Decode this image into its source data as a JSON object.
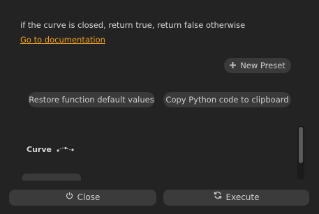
{
  "description": "if the curve is closed, return true, return false otherwise",
  "doc_link": "Go to documentation",
  "presets": {
    "new_preset_label": "New Preset",
    "icon": "plus-icon"
  },
  "actions": {
    "restore_label": "Restore function default values",
    "copy_label": "Copy Python code to clipboard"
  },
  "parameters": [
    {
      "label": "Curve",
      "icon": "curve-icon"
    }
  ],
  "footer": {
    "close_label": "Close",
    "close_icon": "power-icon",
    "execute_label": "Execute",
    "execute_icon": "refresh-icon"
  },
  "colors": {
    "background": "#232323",
    "link": "#f0a020",
    "button": "#3a3a3a"
  }
}
